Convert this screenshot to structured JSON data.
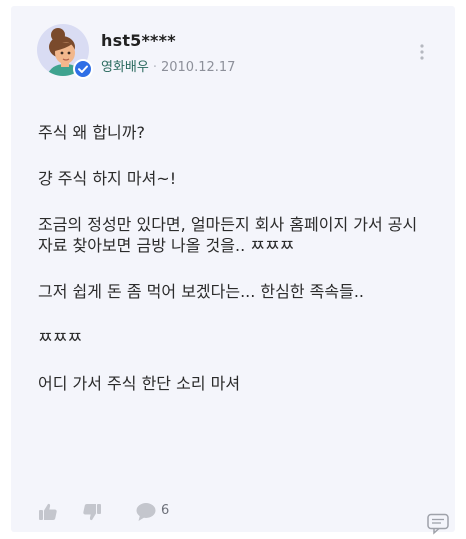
{
  "post": {
    "username": "hst5****",
    "badge": "영화배우",
    "separator": "·",
    "date": "2010.12.17",
    "paragraphs": [
      "주식 왜 합니까?",
      "걍 주식 하지 마셔~!",
      "조금의 정성만 있다면, 얼마든지 회사 홈페이지 가서 공시\n자료 찾아보면 금방 나올 것을.. ㅉㅉㅉ",
      "그저 쉽게 돈 좀 먹어 보겠다는... 한심한 족속들..",
      "ㅉㅉㅉ",
      "어디 가서 주식 한단 소리 마셔"
    ]
  },
  "actions": {
    "like_icon": "thumbs-up-icon",
    "dislike_icon": "thumbs-down-icon",
    "comment_icon": "speech-bubble-icon",
    "comment_count": "6"
  },
  "colors": {
    "card_background": "#f4f5fb",
    "badge_text": "#2a6a5e",
    "verified_badge": "#2f6fe6",
    "icon_gray": "#c4c6cd"
  }
}
